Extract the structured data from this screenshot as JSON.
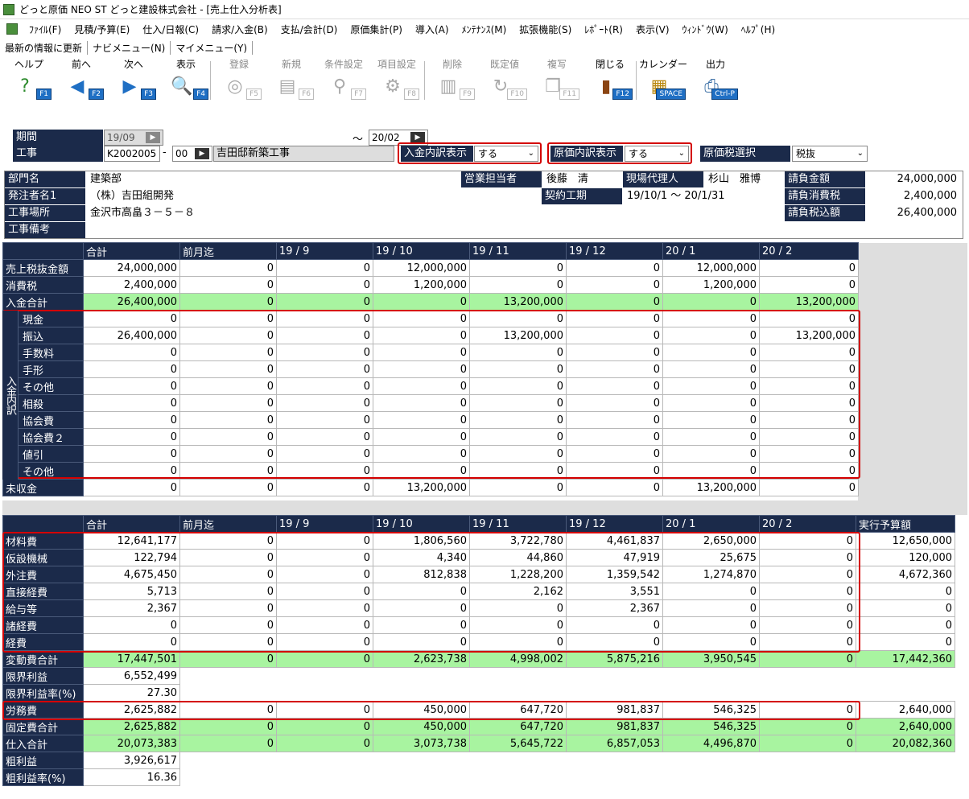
{
  "window": {
    "title": "どっと原価 NEO ST どっと建設株式会社 - [売上仕入分析表]"
  },
  "menu": [
    "ﾌｧｲﾙ(F)",
    "見積/予算(E)",
    "仕入/日報(C)",
    "請求/入金(B)",
    "支払/会計(D)",
    "原価集計(P)",
    "導入(A)",
    "ﾒﾝﾃﾅﾝｽ(M)",
    "拡張機能(S)",
    "ﾚﾎﾟｰﾄ(R)",
    "表示(V)",
    "ｳｨﾝﾄﾞｳ(W)",
    "ﾍﾙﾌﾟ(H)"
  ],
  "links": [
    "最新の情報に更新",
    "ナビメニュー(N)",
    "マイメニュー(Y)"
  ],
  "toolbar": [
    {
      "label": "ヘルプ",
      "key": "F1",
      "icon": "help-icon",
      "glyph": "?",
      "enabled": true
    },
    {
      "label": "前へ",
      "key": "F2",
      "icon": "arrow-left-icon",
      "glyph": "◀",
      "enabled": true
    },
    {
      "label": "次へ",
      "key": "F3",
      "icon": "arrow-right-icon",
      "glyph": "▶",
      "enabled": true
    },
    {
      "label": "表示",
      "key": "F4",
      "icon": "magnifier-icon",
      "glyph": "🔍",
      "enabled": true
    },
    {
      "label": "登録",
      "key": "F5",
      "icon": "disk-icon",
      "glyph": "◎",
      "enabled": false
    },
    {
      "label": "新規",
      "key": "F6",
      "icon": "document-icon",
      "glyph": "▤",
      "enabled": false
    },
    {
      "label": "条件設定",
      "key": "F7",
      "icon": "search-settings-icon",
      "glyph": "⚲",
      "enabled": false
    },
    {
      "label": "項目設定",
      "key": "F8",
      "icon": "gears-icon",
      "glyph": "⚙",
      "enabled": false
    },
    {
      "label": "削除",
      "key": "F9",
      "icon": "trash-icon",
      "glyph": "▥",
      "enabled": false
    },
    {
      "label": "既定値",
      "key": "F10",
      "icon": "refresh-icon",
      "glyph": "↻",
      "enabled": false
    },
    {
      "label": "複写",
      "key": "F11",
      "icon": "copy-icon",
      "glyph": "❐",
      "enabled": false
    },
    {
      "label": "閉じる",
      "key": "F12",
      "icon": "door-exit-icon",
      "glyph": "▮",
      "enabled": true
    },
    {
      "label": "カレンダー",
      "key": "SPACE",
      "icon": "calendar-icon",
      "glyph": "▦",
      "enabled": true
    },
    {
      "label": "出力",
      "key": "Ctrl-P",
      "icon": "print-preview-icon",
      "glyph": "⎙",
      "enabled": true
    }
  ],
  "filters": {
    "period_label": "期間",
    "period_from": "19/09",
    "tilde": "～",
    "period_to": "20/02",
    "project_label": "工事",
    "project_code": "K2002005",
    "dash": "-",
    "project_branch": "00",
    "project_name": "吉田邸新築工事",
    "deposit_detail_label": "入金内訳表示",
    "deposit_detail_value": "する",
    "cost_detail_label": "原価内訳表示",
    "cost_detail_value": "する",
    "tax_label": "原価税選択",
    "tax_value": "税抜"
  },
  "info": {
    "dept_label": "部門名",
    "dept": "建築部",
    "client_label": "発注者名1",
    "client": "（株）吉田組開発",
    "site_label": "工事場所",
    "site": "金沢市高畠３－５－８",
    "note_label": "工事備考",
    "note": "",
    "sales_label": "営業担当者",
    "sales": "後藤　清",
    "agent_label": "現場代理人",
    "agent": "杉山　雅博",
    "period_label": "契約工期",
    "period": "19/10/1 ～ 20/1/31",
    "contract_amount_label": "請負金額",
    "contract_amount": "24,000,000",
    "contract_tax_label": "請負消費税",
    "contract_tax": "2,400,000",
    "contract_total_label": "請負税込額",
    "contract_total": "26,400,000"
  },
  "sales_table": {
    "headers": [
      "",
      "合計",
      "前月迄",
      "19 / 9",
      "19 / 10",
      "19 / 11",
      "19 / 12",
      "20 / 1",
      "20 / 2"
    ],
    "group_label": "入金内訳",
    "rows": [
      {
        "label": "売上税抜金額",
        "values": [
          "24,000,000",
          "0",
          "0",
          "12,000,000",
          "0",
          "0",
          "12,000,000",
          "0"
        ]
      },
      {
        "label": "消費税",
        "values": [
          "2,400,000",
          "0",
          "0",
          "1,200,000",
          "0",
          "0",
          "1,200,000",
          "0"
        ]
      },
      {
        "label": "入金合計",
        "green": true,
        "values": [
          "26,400,000",
          "0",
          "0",
          "0",
          "13,200,000",
          "0",
          "0",
          "13,200,000"
        ]
      },
      {
        "label": "現金",
        "sub": true,
        "values": [
          "0",
          "0",
          "0",
          "0",
          "0",
          "0",
          "0",
          "0"
        ]
      },
      {
        "label": "振込",
        "sub": true,
        "values": [
          "26,400,000",
          "0",
          "0",
          "0",
          "13,200,000",
          "0",
          "0",
          "13,200,000"
        ]
      },
      {
        "label": "手数料",
        "sub": true,
        "values": [
          "0",
          "0",
          "0",
          "0",
          "0",
          "0",
          "0",
          "0"
        ]
      },
      {
        "label": "手形",
        "sub": true,
        "values": [
          "0",
          "0",
          "0",
          "0",
          "0",
          "0",
          "0",
          "0"
        ]
      },
      {
        "label": "その他",
        "sub": true,
        "values": [
          "0",
          "0",
          "0",
          "0",
          "0",
          "0",
          "0",
          "0"
        ]
      },
      {
        "label": "相殺",
        "sub": true,
        "values": [
          "0",
          "0",
          "0",
          "0",
          "0",
          "0",
          "0",
          "0"
        ]
      },
      {
        "label": "協会費",
        "sub": true,
        "values": [
          "0",
          "0",
          "0",
          "0",
          "0",
          "0",
          "0",
          "0"
        ]
      },
      {
        "label": "協会費２",
        "sub": true,
        "values": [
          "0",
          "0",
          "0",
          "0",
          "0",
          "0",
          "0",
          "0"
        ]
      },
      {
        "label": "値引",
        "sub": true,
        "values": [
          "0",
          "0",
          "0",
          "0",
          "0",
          "0",
          "0",
          "0"
        ]
      },
      {
        "label": "その他",
        "sub": true,
        "values": [
          "0",
          "0",
          "0",
          "0",
          "0",
          "0",
          "0",
          "0"
        ]
      },
      {
        "label": "未収金",
        "values": [
          "0",
          "0",
          "0",
          "13,200,000",
          "0",
          "0",
          "13,200,000",
          "0"
        ]
      }
    ]
  },
  "cost_table": {
    "headers": [
      "",
      "合計",
      "前月迄",
      "19 / 9",
      "19 / 10",
      "19 / 11",
      "19 / 12",
      "20 / 1",
      "20 / 2",
      "実行予算額"
    ],
    "rows": [
      {
        "label": "材料費",
        "values": [
          "12,641,177",
          "0",
          "0",
          "1,806,560",
          "3,722,780",
          "4,461,837",
          "2,650,000",
          "0",
          "12,650,000"
        ]
      },
      {
        "label": "仮設機械",
        "values": [
          "122,794",
          "0",
          "0",
          "4,340",
          "44,860",
          "47,919",
          "25,675",
          "0",
          "120,000"
        ]
      },
      {
        "label": "外注費",
        "values": [
          "4,675,450",
          "0",
          "0",
          "812,838",
          "1,228,200",
          "1,359,542",
          "1,274,870",
          "0",
          "4,672,360"
        ]
      },
      {
        "label": "直接経費",
        "values": [
          "5,713",
          "0",
          "0",
          "0",
          "2,162",
          "3,551",
          "0",
          "0",
          "0"
        ]
      },
      {
        "label": "給与等",
        "values": [
          "2,367",
          "0",
          "0",
          "0",
          "0",
          "2,367",
          "0",
          "0",
          "0"
        ]
      },
      {
        "label": "諸経費",
        "values": [
          "0",
          "0",
          "0",
          "0",
          "0",
          "0",
          "0",
          "0",
          "0"
        ]
      },
      {
        "label": "経費",
        "values": [
          "0",
          "0",
          "0",
          "0",
          "0",
          "0",
          "0",
          "0",
          "0"
        ]
      },
      {
        "label": "変動費合計",
        "green": true,
        "values": [
          "17,447,501",
          "0",
          "0",
          "2,623,738",
          "4,998,002",
          "5,875,216",
          "3,950,545",
          "0",
          "17,442,360"
        ]
      },
      {
        "label": "限界利益",
        "values": [
          "6,552,499"
        ]
      },
      {
        "label": "限界利益率(%)",
        "values": [
          "27.30"
        ]
      },
      {
        "label": "労務費",
        "values": [
          "2,625,882",
          "0",
          "0",
          "450,000",
          "647,720",
          "981,837",
          "546,325",
          "0",
          "2,640,000"
        ]
      },
      {
        "label": "固定費合計",
        "green": true,
        "values": [
          "2,625,882",
          "0",
          "0",
          "450,000",
          "647,720",
          "981,837",
          "546,325",
          "0",
          "2,640,000"
        ]
      },
      {
        "label": "仕入合計",
        "green": true,
        "values": [
          "20,073,383",
          "0",
          "0",
          "3,073,738",
          "5,645,722",
          "6,857,053",
          "4,496,870",
          "0",
          "20,082,360"
        ]
      },
      {
        "label": "粗利益",
        "values": [
          "3,926,617"
        ]
      },
      {
        "label": "粗利益率(%)",
        "values": [
          "16.36"
        ]
      }
    ]
  },
  "colors": {
    "header_navy": "#1b2a4a",
    "total_green": "#a8f4a0",
    "highlight_red": "#d40000"
  }
}
